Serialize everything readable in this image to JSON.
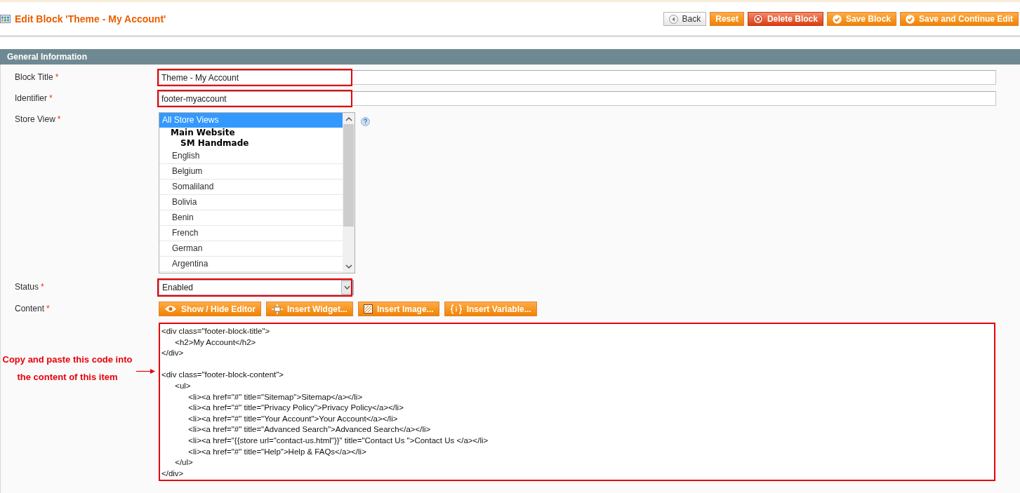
{
  "header": {
    "title": "Edit Block 'Theme - My Account'",
    "buttons": [
      {
        "label": "Back",
        "kind": "back"
      },
      {
        "label": "Reset",
        "kind": "plain"
      },
      {
        "label": "Delete Block",
        "kind": "delete"
      },
      {
        "label": "Save Block",
        "kind": "save"
      },
      {
        "label": "Save and Continue Edit",
        "kind": "save"
      }
    ]
  },
  "section": {
    "title": "General Information"
  },
  "form": {
    "block_title": {
      "label": "Block Title",
      "required": "*",
      "value": "Theme - My Account"
    },
    "identifier": {
      "label": "Identifier",
      "required": "*",
      "value": "footer-myaccount"
    },
    "store_view": {
      "label": "Store View",
      "required": "*",
      "options": [
        {
          "label": "All Store Views",
          "kind": "option",
          "selected": true
        },
        {
          "label": "Main Website",
          "kind": "group",
          "children": [
            {
              "label": "SM Handmade",
              "kind": "group",
              "children": [
                {
                  "label": "English",
                  "kind": "option",
                  "selected": false
                },
                {
                  "label": "Belgium",
                  "kind": "option",
                  "selected": false
                },
                {
                  "label": "Somaliland",
                  "kind": "option",
                  "selected": false
                },
                {
                  "label": "Bolivia",
                  "kind": "option",
                  "selected": false
                },
                {
                  "label": "Benin",
                  "kind": "option",
                  "selected": false
                },
                {
                  "label": "French",
                  "kind": "option",
                  "selected": false
                },
                {
                  "label": "German",
                  "kind": "option",
                  "selected": false
                },
                {
                  "label": "Argentina",
                  "kind": "option",
                  "selected": false
                }
              ]
            }
          ]
        }
      ]
    },
    "status": {
      "label": "Status",
      "required": "*",
      "value": "Enabled"
    },
    "content": {
      "label": "Content",
      "required": "*",
      "buttons": [
        {
          "label": "Show / Hide Editor",
          "kind": "eye"
        },
        {
          "label": "Insert Widget...",
          "kind": "widget"
        },
        {
          "label": "Insert Image...",
          "kind": "image"
        },
        {
          "label": "Insert Variable...",
          "kind": "variable"
        }
      ],
      "value": "<div class=\"footer-block-title\">\n\t<h2>My Account</h2>\n</div>\n\n<div class=\"footer-block-content\">\n\t<ul>\n\t\t<li><a href=\"#\" title=\"Sitemap\">Sitemap</a></li>\n\t\t<li><a href=\"#\" title=\"Privacy Policy\">Privacy Policy</a></li>\n\t\t<li><a href=\"#\" title=\"Your Account\">Your Account</a></li>\n\t\t<li><a href=\"#\" title=\"Advanced Search\">Advanced Search</a></li>\n\t\t<li><a href=\"{{store url=\"contact-us.html\"}}\" title=\"Contact Us \">Contact Us </a></li>\n\t\t<li><a href=\"#\" title=\"Help\">Help & FAQs</a></li>\n\t</ul>\n</div>"
    }
  },
  "annotation": {
    "text": "Copy and paste this code into the content of this item"
  }
}
